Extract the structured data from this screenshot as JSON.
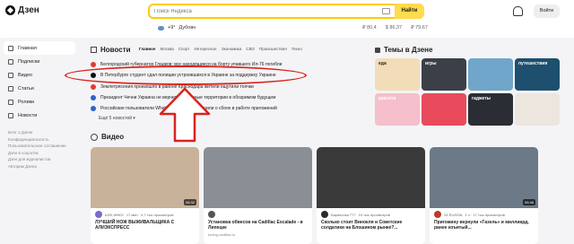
{
  "app": {
    "logo": "Дзен"
  },
  "search": {
    "placeholder": "Поиск Яндекса",
    "button": "Найти"
  },
  "weather": {
    "temp": "+9°",
    "city": "Дубовн"
  },
  "rates": [
    "₽ 80,4",
    "$ 86,37",
    "₽ 79,67"
  ],
  "header": {
    "login": "Войти"
  },
  "sidebar": {
    "items": [
      {
        "label": "Главная",
        "icon": "home-icon",
        "active": true
      },
      {
        "label": "Подписки",
        "icon": "subscriptions-icon"
      },
      {
        "label": "Видео",
        "icon": "video-icon"
      },
      {
        "label": "Статьи",
        "icon": "articles-icon"
      },
      {
        "label": "Ролики",
        "icon": "shorts-icon"
      },
      {
        "label": "Новости",
        "icon": "news-icon"
      }
    ],
    "links": [
      "Блог о Дзене",
      "Конфиденциальность",
      "Пользовательское соглашение",
      "Дзен в соцсетях",
      "Дзен для журналистов",
      "Авторам Дзена"
    ]
  },
  "news": {
    "title": "Новости",
    "tabs": [
      "Главное",
      "Москва",
      "Спорт",
      "Интересное",
      "Экономика",
      "СВО",
      "Происшествия",
      "Техно"
    ],
    "items": [
      {
        "text": "Белгородский губернатор Гладков: все находящиеся на борту упавшего Ил-76 погибли",
        "color": "#e23b2e"
      },
      {
        "text": "В Петербурге студент сдал полиции устроившихся в Украине за поддержку Украине",
        "color": "#111111"
      },
      {
        "text": "Землетрясения произошло в районе Краснодара жители ощутили толчки",
        "color": "#e23b2e"
      },
      {
        "text": "Президент Чечни Украина не вернет утраченные территории в обозримом будущем",
        "color": "#2e63c8"
      },
      {
        "text": "Российские пользователи WhatsApp и Viber сообщили о сбоях в работе приложений",
        "color": "#2e63c8"
      }
    ],
    "more": "Ещё 5 новостей ▾"
  },
  "themes": {
    "title": "Темы в Дзене",
    "items": [
      {
        "label": "еда",
        "bg": "#f2ddb8",
        "fg": "#222222"
      },
      {
        "label": "игры",
        "bg": "#3b3f48",
        "fg": "#ffffff"
      },
      {
        "label": "",
        "bg": "#6fa6c9",
        "fg": "#ffffff"
      },
      {
        "label": "путешествия",
        "bg": "#1f4f6e",
        "fg": "#ffffff"
      },
      {
        "label": "красота",
        "bg": "#f5bfcb",
        "fg": "#ffffff"
      },
      {
        "label": "",
        "bg": "#e84a5b",
        "fg": "#ffffff"
      },
      {
        "label": "гаджеты",
        "bg": "#2a2d33",
        "fg": "#ffffff"
      },
      {
        "label": "",
        "bg": "#ece6df",
        "fg": "#222222"
      }
    ]
  },
  "video": {
    "title": "Видео",
    "cards": [
      {
        "author": "ШУК ИНКО",
        "meta": "17 мин · 4,7 тыс просмотров",
        "title": "ЛУЧШИЙ НОЖ ВЫЖИВАЛЬЩИКА С АЛИЭКСПРЕСС",
        "sub": "",
        "duration": "08:32",
        "thumb": "#c9b29a",
        "av": "#7a6cc9"
      },
      {
        "author": "",
        "meta": "",
        "title": "Установка обвесов на Cadillac Escalade - в Липецке",
        "sub": "tuning-cadillac.ru",
        "duration": "",
        "thumb": "#8a8f96",
        "av": "#555555"
      },
      {
        "author": "Барахолка 777",
        "meta": "19 тыс просмотров",
        "title": "Сколько стоит Винокля и Советские солдатики на Блошином рынке?...",
        "sub": "",
        "duration": "",
        "thumb": "#3a3a3a",
        "av": "#2b2b2b"
      },
      {
        "author": "24 RUSSIA",
        "meta": "1 ч · 17 тыс просмотров",
        "title": "Пригожину вернули «Газель» и миллиард, ранее изъятый...",
        "sub": "",
        "duration": "05:46",
        "thumb": "#6b7a86",
        "av": "#c0392b"
      }
    ]
  },
  "annotation": {
    "color": "#d8241d"
  }
}
